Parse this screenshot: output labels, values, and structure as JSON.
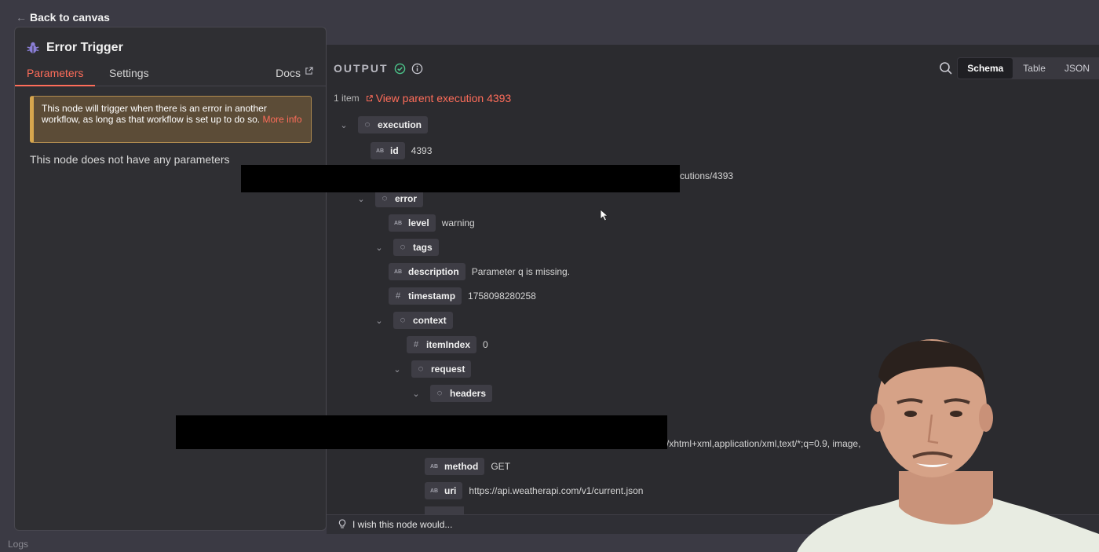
{
  "nav": {
    "back_label": "Back to canvas"
  },
  "node_panel": {
    "title": "Error Trigger",
    "tabs": {
      "parameters": "Parameters",
      "settings": "Settings",
      "docs": "Docs"
    },
    "callout": {
      "text": "This node will trigger when there is an error in another workflow, as long as that workflow is set up to do so.",
      "link": "More info"
    },
    "no_params": "This node does not have any parameters"
  },
  "output": {
    "label": "OUTPUT",
    "view_modes": {
      "schema": "Schema",
      "table": "Table",
      "json": "JSON"
    },
    "item_count": "1 item",
    "parent_link": "View parent execution 4393",
    "tree": {
      "execution": "execution",
      "id_key": "id",
      "id_val": "4393",
      "url_partial": "cutions/4393",
      "error": "error",
      "level_key": "level",
      "level_val": "warning",
      "tags": "tags",
      "description_key": "description",
      "description_val": "Parameter q is missing.",
      "timestamp_key": "timestamp",
      "timestamp_val": "1758098280258",
      "context": "context",
      "itemindex_key": "itemIndex",
      "itemindex_val": "0",
      "request": "request",
      "headers": "headers",
      "accept_partial": "/xhtml+xml,application/xml,text/*;q=0.9, image,",
      "method_key": "method",
      "method_val": "GET",
      "uri_key": "uri",
      "uri_val": "https://api.weatherapi.com/v1/current.json"
    }
  },
  "footer": {
    "hint": "I wish this node would...",
    "logs": "Logs"
  },
  "colors": {
    "accent": "#ff6d5a",
    "warning_border": "#d7a64d",
    "success": "#4cc38a"
  }
}
